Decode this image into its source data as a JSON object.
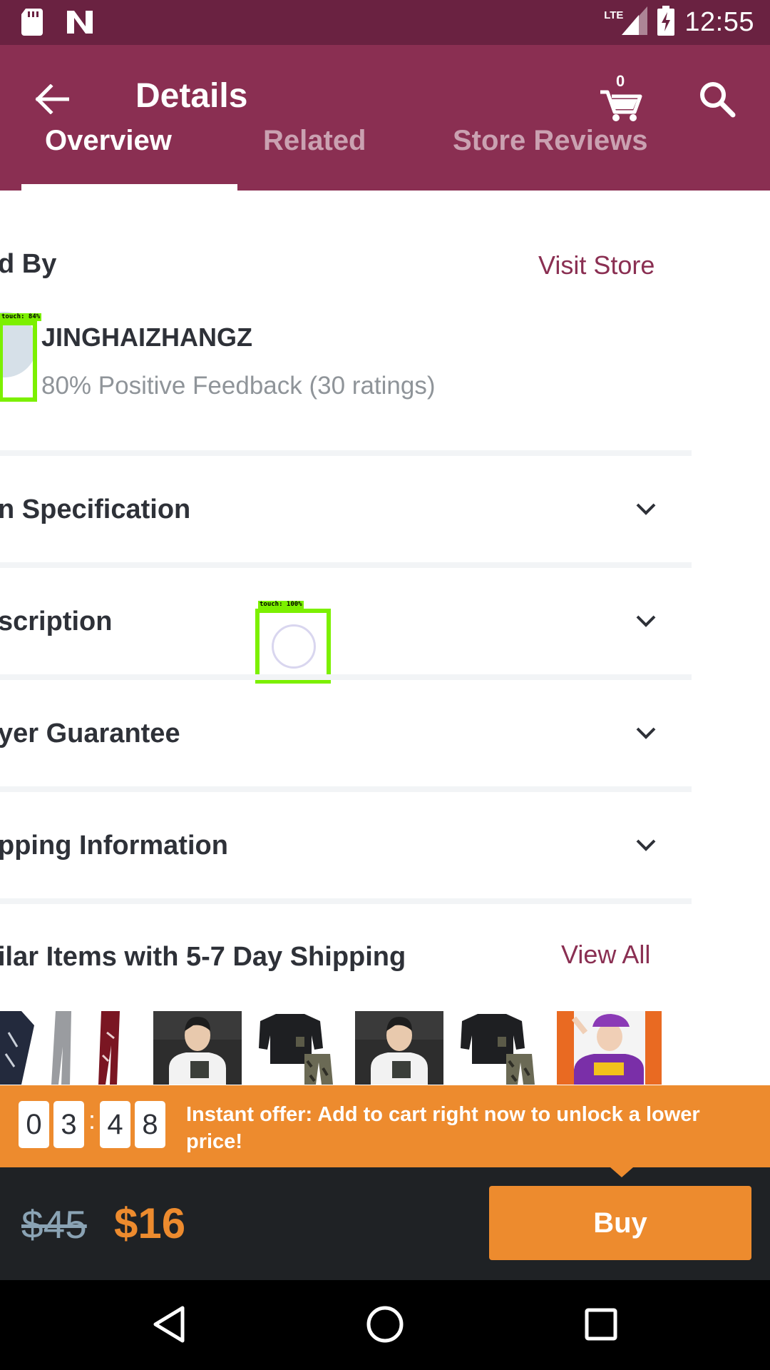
{
  "status_bar": {
    "time": "12:55",
    "network": "LTE",
    "icons": [
      "sd-card-icon",
      "n-notification-icon",
      "signal-icon",
      "battery-charging-icon"
    ]
  },
  "app_bar": {
    "title": "Details",
    "cart_count": "0",
    "tabs": [
      {
        "label": "Overview",
        "active": true
      },
      {
        "label": "Related",
        "active": false
      },
      {
        "label": "Store Reviews",
        "active": false
      }
    ]
  },
  "seller": {
    "heading": "d By",
    "visit_store": "Visit Store",
    "name": "JINGHAIZHANGZ",
    "feedback": "80% Positive Feedback (30 ratings)"
  },
  "sections": [
    {
      "label": "n Specification"
    },
    {
      "label": "scription"
    },
    {
      "label": "yer Guarantee"
    },
    {
      "label": "pping Information"
    }
  ],
  "similar": {
    "heading": "ilar Items with 5-7 Day Shipping",
    "view_all": "View All"
  },
  "touch_indicators": [
    {
      "label": "touch: 84%"
    },
    {
      "label": "touch: 100%"
    }
  ],
  "offer": {
    "digits": [
      "0",
      "3",
      "4",
      "8"
    ],
    "separator": ":",
    "text": "Instant offer: Add to cart right now to unlock a lower price!"
  },
  "price_bar": {
    "old_price": "$45",
    "new_price": "$16",
    "buy_label": "Buy"
  },
  "colors": {
    "status_bar": "#6a2241",
    "app_bar": "#8a2f52",
    "accent_orange": "#ed8b2e",
    "price_bar": "#1f2225",
    "touch_highlight": "#7cf000"
  }
}
